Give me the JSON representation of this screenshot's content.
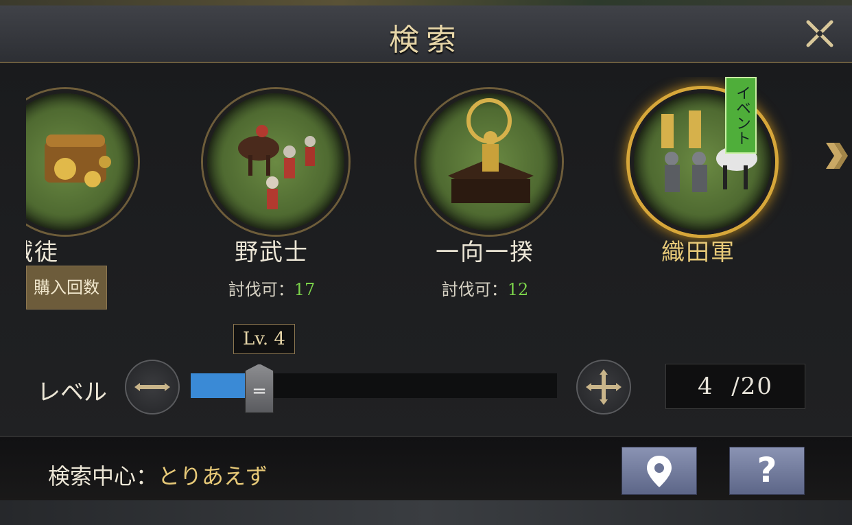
{
  "dialog": {
    "title": "検索"
  },
  "targets": [
    {
      "name": "賊徒",
      "badge": "購入回数"
    },
    {
      "name": "野武士",
      "info_label": "討伐可：",
      "info_value": "17"
    },
    {
      "name": "一向一揆",
      "info_label": "討伐可：",
      "info_value": "12"
    },
    {
      "name": "織田軍",
      "tag": "イベント",
      "selected": true
    }
  ],
  "level": {
    "row_label": "レベル",
    "bubble": "Lv. 4",
    "current": "4",
    "max": "/20",
    "fraction": 0.17,
    "thumb_glyph": "="
  },
  "footer": {
    "center_label": "検索中心：",
    "center_value": "とりあえず",
    "help_glyph": "?"
  },
  "colors": {
    "accent_gold": "#e7c978",
    "slider_fill": "#3a8ad6",
    "count_green": "#7bd24a",
    "event_green": "#4fae3a"
  }
}
